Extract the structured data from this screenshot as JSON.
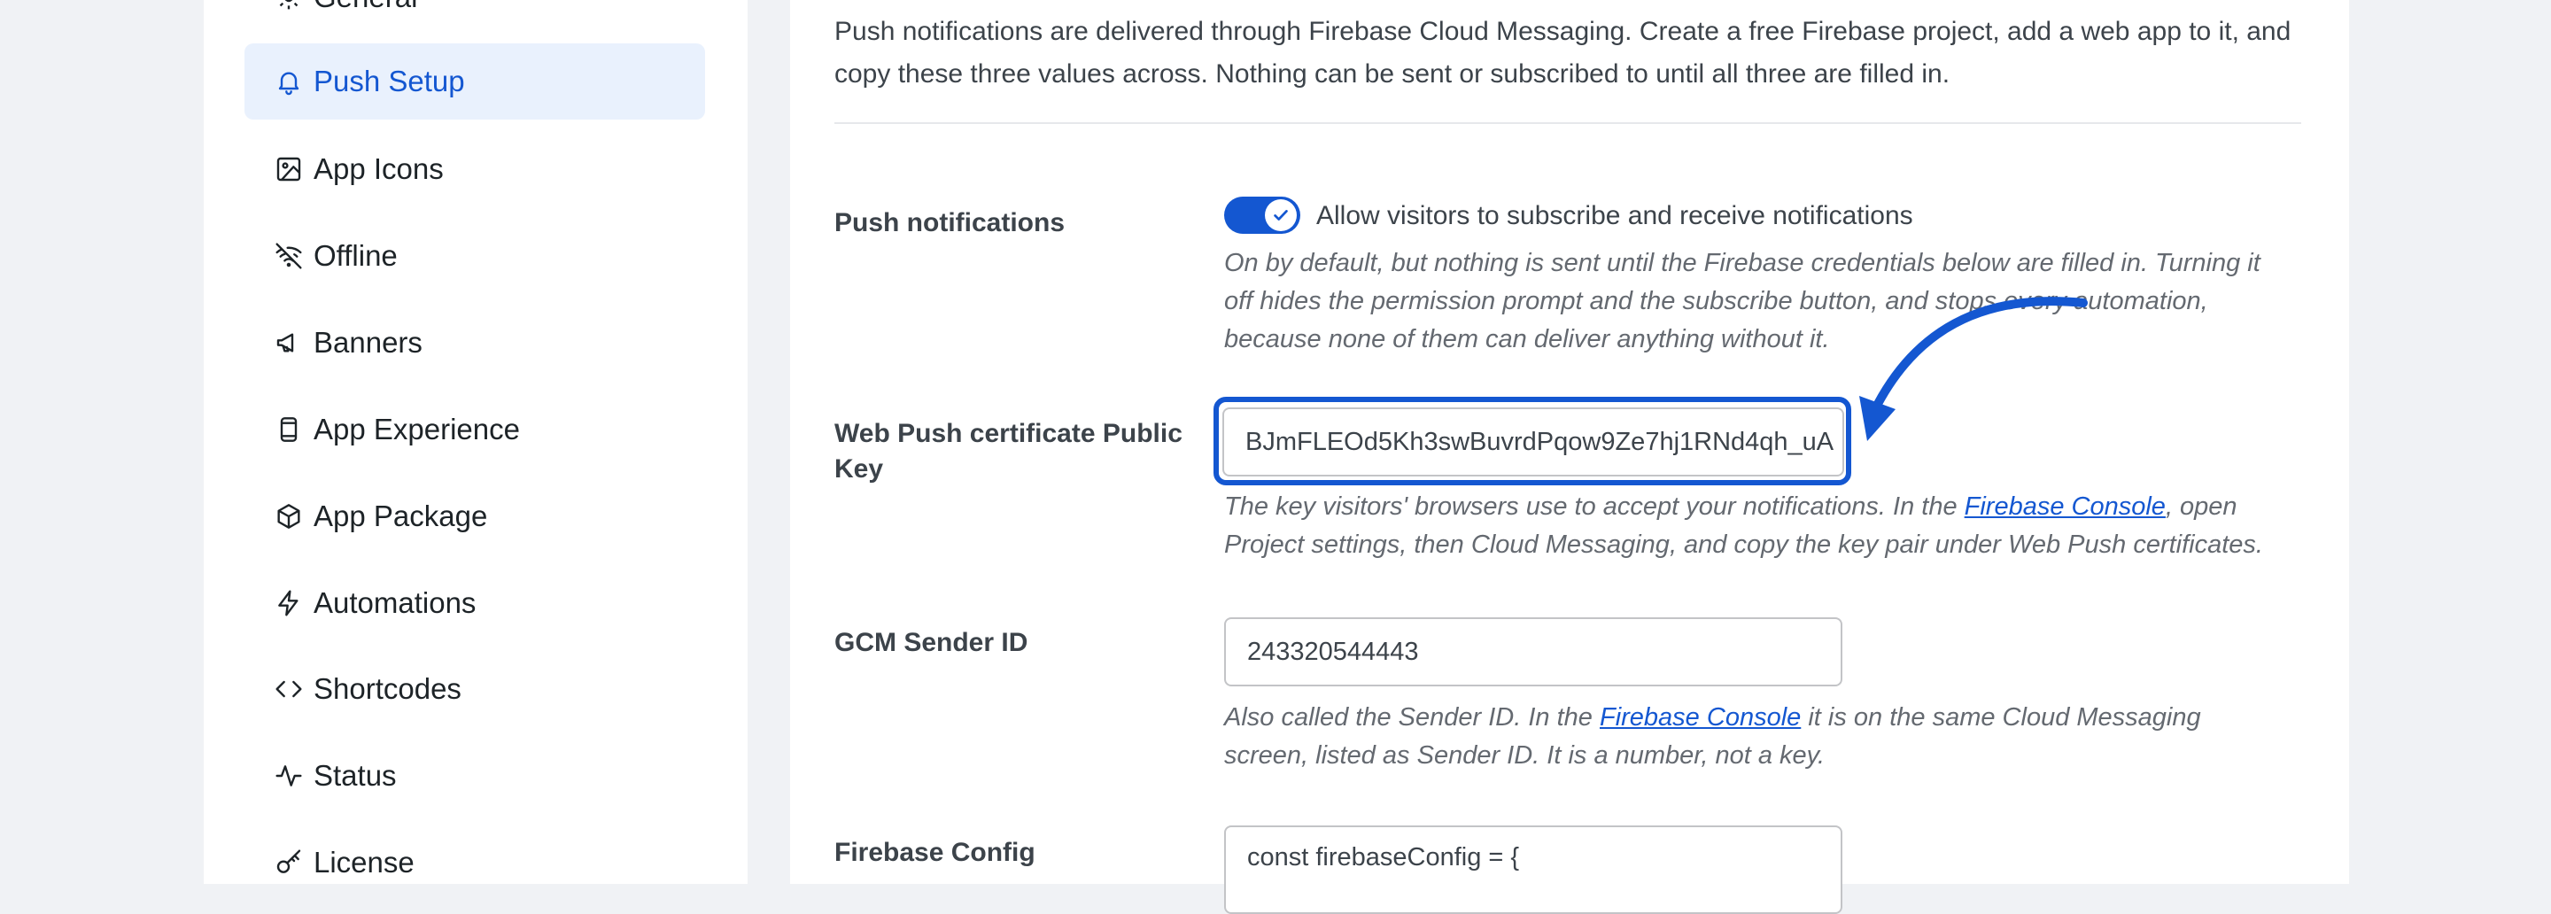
{
  "sidebar": {
    "items": [
      {
        "label": "General",
        "icon": "gear-icon"
      },
      {
        "label": "Push Setup",
        "icon": "bell-icon",
        "active": true
      },
      {
        "label": "App Icons",
        "icon": "image-icon"
      },
      {
        "label": "Offline",
        "icon": "wifi-off-icon"
      },
      {
        "label": "Banners",
        "icon": "megaphone-icon"
      },
      {
        "label": "App Experience",
        "icon": "phone-icon"
      },
      {
        "label": "App Package",
        "icon": "package-icon"
      },
      {
        "label": "Automations",
        "icon": "bolt-icon"
      },
      {
        "label": "Shortcodes",
        "icon": "code-icon"
      },
      {
        "label": "Status",
        "icon": "activity-icon"
      },
      {
        "label": "License",
        "icon": "key-icon"
      }
    ]
  },
  "main": {
    "intro": "Push notifications are delivered through Firebase Cloud Messaging. Create a free Firebase project, add a web app to it, and copy these three values across. Nothing can be sent or subscribed to until all three are filled in.",
    "push": {
      "label": "Push notifications",
      "toggle_on": true,
      "toggle_text": "Allow visitors to subscribe and receive notifications",
      "desc": "On by default, but nothing is sent until the Firebase credentials below are filled in. Turning it off hides the permission prompt and the subscribe button, and stops every automation, because none of them can deliver anything without it."
    },
    "vapid": {
      "label": "Web Push certificate Public Key",
      "value": "BJmFLEOd5Kh3swBuvrdPqow9Ze7hj1RNd4qh_uA",
      "desc_before": "The key visitors' browsers use to accept your notifications. In the ",
      "link": "Firebase Console",
      "desc_after": ", open Project settings, then Cloud Messaging, and copy the key pair under Web Push certificates."
    },
    "gcm": {
      "label": "GCM Sender ID",
      "value": "243320544443",
      "desc_before": "Also called the Sender ID. In the ",
      "link": "Firebase Console",
      "desc_after": " it is on the same Cloud Messaging screen, listed as Sender ID. It is a number, not a key."
    },
    "config": {
      "label": "Firebase Config",
      "value": "const firebaseConfig = {"
    }
  },
  "colors": {
    "accent": "#1457d1",
    "active_bg": "#e9f1fd"
  }
}
